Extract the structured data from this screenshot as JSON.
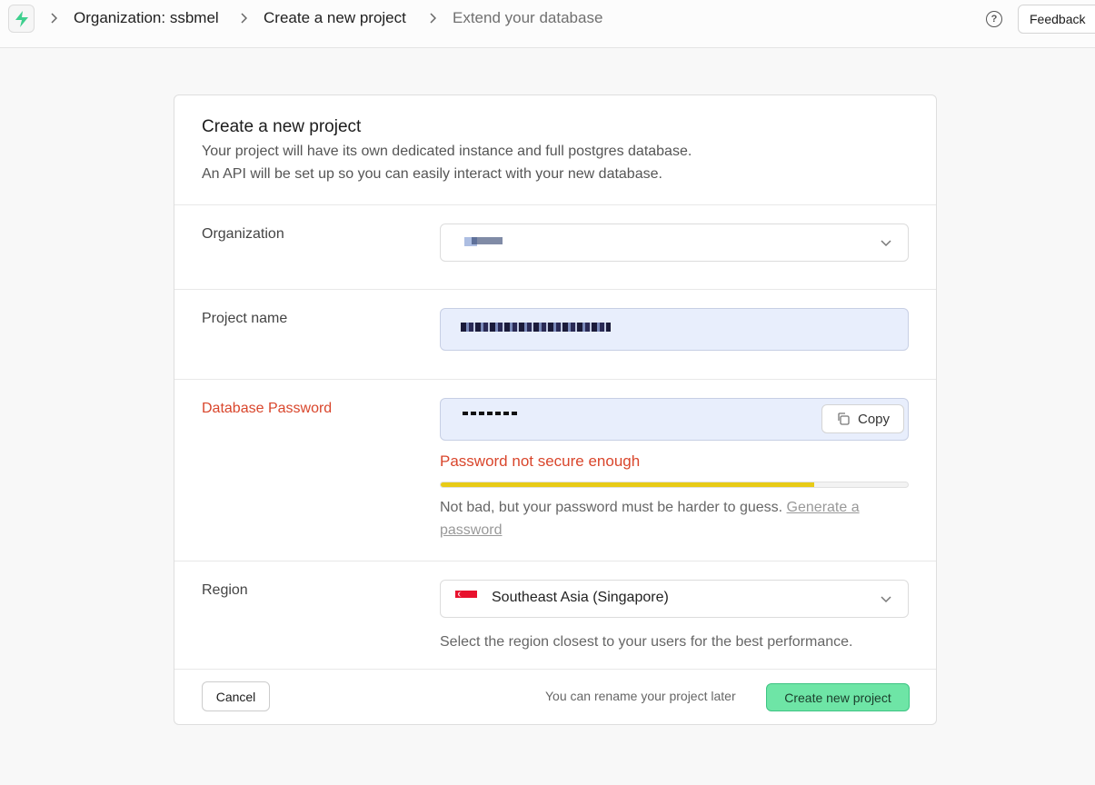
{
  "colors": {
    "brand_green": "#3ecf8e",
    "error": "#d9462c",
    "strength_bar": "#e8cb17",
    "primary_button": "#6ee5a6"
  },
  "topbar": {
    "logo_icon": "bolt-icon",
    "breadcrumbs": [
      "Organization: ssbmel",
      "Create a new project",
      "Extend your database"
    ],
    "help_icon": "question-circle-icon",
    "feedback_label": "Feedback"
  },
  "card": {
    "title": "Create a new project",
    "description_line1": "Your project will have its own dedicated instance and full postgres database.",
    "description_line2": "An API will be set up so you can easily interact with your new database."
  },
  "organization": {
    "label": "Organization",
    "value_redacted": true
  },
  "project_name": {
    "label": "Project name",
    "value_redacted": true
  },
  "password": {
    "label": "Database Password",
    "value_redacted": true,
    "copy_label": "Copy",
    "copy_icon": "copy-icon",
    "error_message": "Password not secure enough",
    "strength": 0.8,
    "hint": "Not bad, but your password must be harder to guess.",
    "generate_link": "Generate a password"
  },
  "region": {
    "label": "Region",
    "flag_icon": "singapore-flag-icon",
    "value": "Southeast Asia (Singapore)",
    "hint": "Select the region closest to your users for the best performance."
  },
  "footer": {
    "cancel_label": "Cancel",
    "note": "You can rename your project later",
    "create_label": "Create new project"
  }
}
